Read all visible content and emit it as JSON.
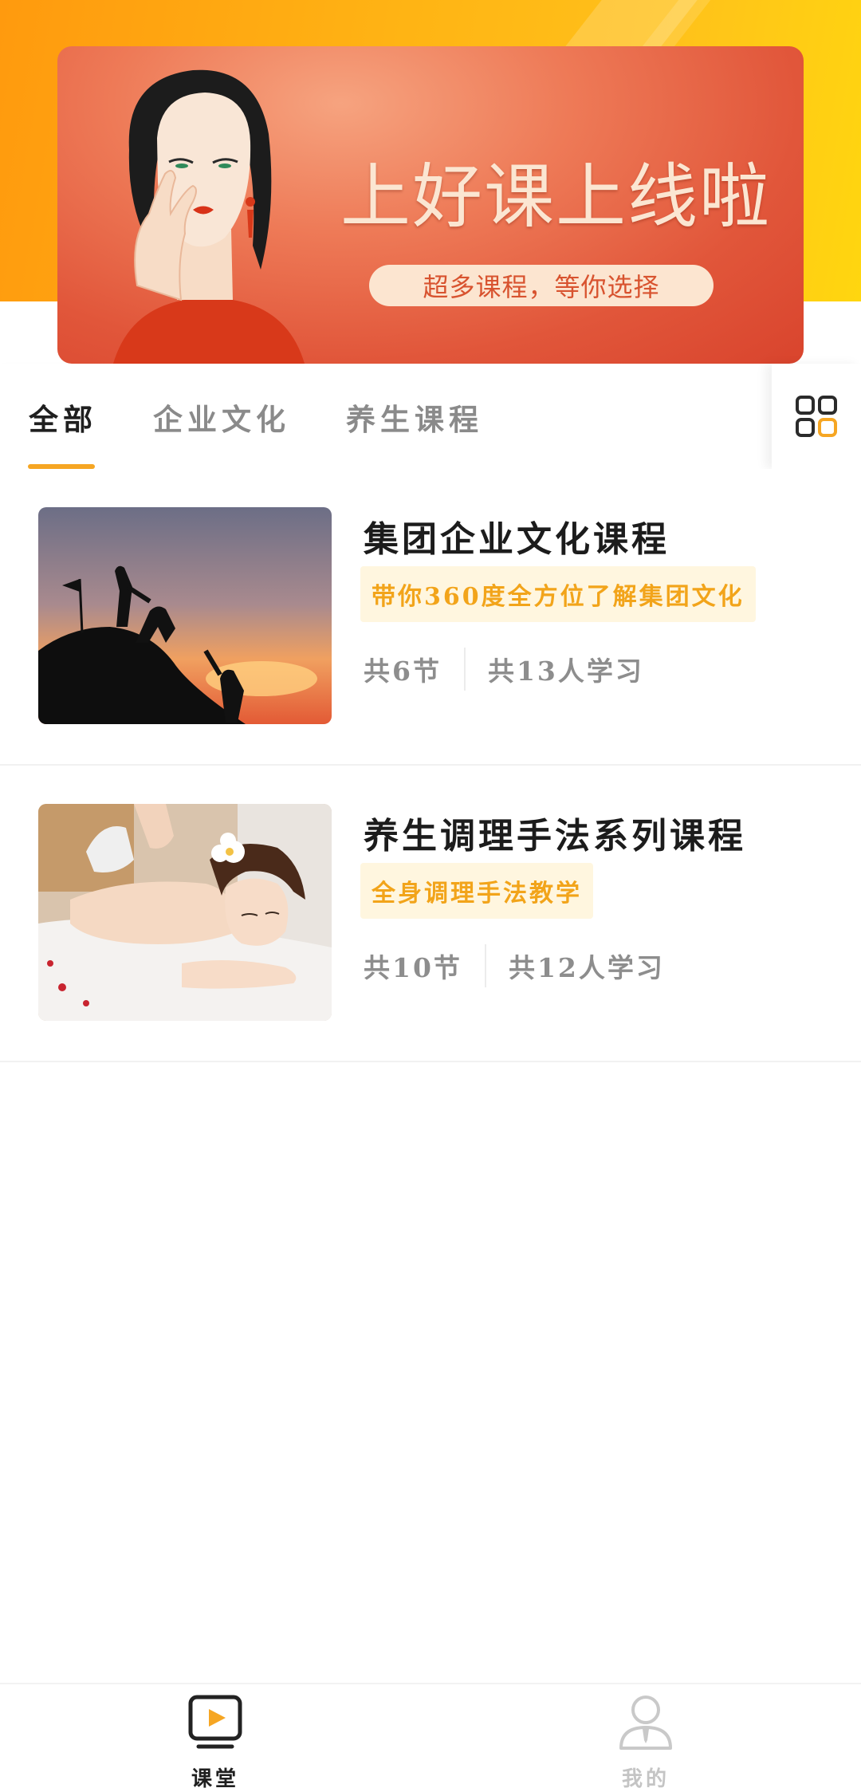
{
  "banner": {
    "title": "上好课上线啦",
    "subtitle": "超多课程，等你选择"
  },
  "tabs": [
    {
      "label": "全部",
      "active": true
    },
    {
      "label": "企业文化",
      "active": false
    },
    {
      "label": "养生课程",
      "active": false
    }
  ],
  "tabs_menu_icon": "grid-icon",
  "courses": [
    {
      "title": "集团企业文化课程",
      "tag": "带你360度全方位了解集团文化",
      "sections": "共6节",
      "learners": "共13人学习",
      "image": "mountain-climbers-silhouette"
    },
    {
      "title": "养生调理手法系列课程",
      "tag": "全身调理手法教学",
      "sections": "共10节",
      "learners": "共12人学习",
      "image": "massage-woman"
    }
  ],
  "bottom_nav": [
    {
      "label": "课堂",
      "icon": "classroom-play-icon",
      "active": true
    },
    {
      "label": "我的",
      "icon": "profile-icon",
      "active": false
    }
  ],
  "colors": {
    "accent": "#f6a623",
    "tag_bg": "#fff6df",
    "tag_text": "#f2a41a",
    "banner_red": "#e1563a",
    "hero_yellow": "#ffb414"
  }
}
